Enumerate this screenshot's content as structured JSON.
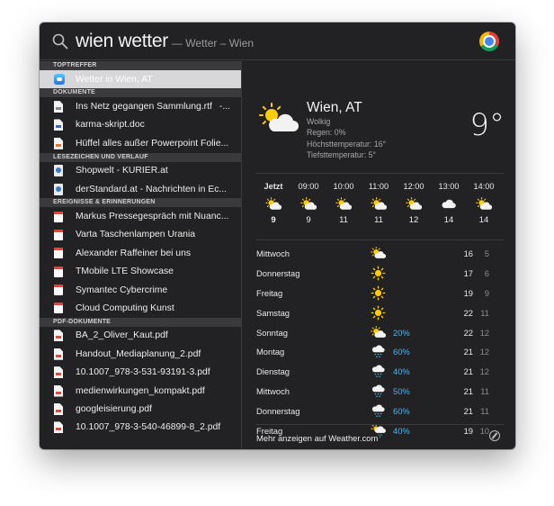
{
  "search": {
    "query": "wien wetter",
    "hint": "— Wetter – Wien"
  },
  "sections": [
    {
      "header": "TOPTREFFER",
      "items": [
        {
          "label": "Wetter in Wien, AT",
          "icon": "weather-app-icon",
          "selected": true
        }
      ]
    },
    {
      "header": "DOKUMENTE",
      "items": [
        {
          "label": "Ins Netz gegangen Sammlung.rtf",
          "suffix": "-...",
          "icon": "rtf"
        },
        {
          "label": "karma-skript.doc",
          "icon": "word"
        },
        {
          "label": "Hüffel alles außer Powerpoint Folie...",
          "icon": "ppt"
        }
      ]
    },
    {
      "header": "LESEZEICHEN UND VERLAUF",
      "items": [
        {
          "label": "Shopwelt - KURIER.at",
          "icon": "web"
        },
        {
          "label": "derStandard.at - Nachrichten in Ec...",
          "icon": "web"
        }
      ]
    },
    {
      "header": "EREIGNISSE & ERINNERUNGEN",
      "items": [
        {
          "label": "Markus Pressegespräch mit Nuanc...",
          "icon": "cal"
        },
        {
          "label": "Varta Taschenlampen Urania",
          "icon": "cal"
        },
        {
          "label": "Alexander Raffeiner bei uns",
          "icon": "cal"
        },
        {
          "label": "TMobile LTE Showcase",
          "icon": "cal"
        },
        {
          "label": "Symantec Cybercrime",
          "icon": "cal"
        },
        {
          "label": "Cloud Computing Kunst",
          "icon": "cal"
        }
      ]
    },
    {
      "header": "PDF-DOKUMENTE",
      "items": [
        {
          "label": "BA_2_Oliver_Kaut.pdf",
          "icon": "pdf"
        },
        {
          "label": "Handout_Mediaplanung_2.pdf",
          "icon": "pdf"
        },
        {
          "label": "10.1007_978-3-531-93191-3.pdf",
          "icon": "pdf"
        },
        {
          "label": "medienwirkungen_kompakt.pdf",
          "icon": "pdf"
        },
        {
          "label": "googleisierung.pdf",
          "icon": "pdf"
        },
        {
          "label": "10.1007_978-3-540-46899-8_2.pdf",
          "icon": "pdf"
        }
      ]
    }
  ],
  "weather": {
    "city": "Wien, AT",
    "condition": "Wolkig",
    "rain": "Regen: 0%",
    "high": "Höchsttemperatur: 16°",
    "low": "Tiefsttemperatur: 5°",
    "current_temp": "9°",
    "hourly": [
      {
        "time": "Jetzt",
        "temp": "9",
        "icon": "partly-sunny"
      },
      {
        "time": "09:00",
        "temp": "9",
        "icon": "partly-sunny"
      },
      {
        "time": "10:00",
        "temp": "11",
        "icon": "partly-sunny"
      },
      {
        "time": "11:00",
        "temp": "11",
        "icon": "partly-sunny"
      },
      {
        "time": "12:00",
        "temp": "12",
        "icon": "partly-sunny"
      },
      {
        "time": "13:00",
        "temp": "14",
        "icon": "cloud"
      },
      {
        "time": "14:00",
        "temp": "14",
        "icon": "partly-sunny"
      }
    ],
    "daily": [
      {
        "day": "Mittwoch",
        "icon": "partly-sunny",
        "rain": "",
        "hi": "16",
        "lo": "5"
      },
      {
        "day": "Donnerstag",
        "icon": "sun",
        "rain": "",
        "hi": "17",
        "lo": "6"
      },
      {
        "day": "Freitag",
        "icon": "sun",
        "rain": "",
        "hi": "19",
        "lo": "9"
      },
      {
        "day": "Samstag",
        "icon": "sun",
        "rain": "",
        "hi": "22",
        "lo": "11"
      },
      {
        "day": "Sonntag",
        "icon": "partly-sunny",
        "rain": "20%",
        "hi": "22",
        "lo": "12"
      },
      {
        "day": "Montag",
        "icon": "rain",
        "rain": "60%",
        "hi": "21",
        "lo": "12"
      },
      {
        "day": "Dienstag",
        "icon": "rain",
        "rain": "40%",
        "hi": "21",
        "lo": "12"
      },
      {
        "day": "Mittwoch",
        "icon": "rain",
        "rain": "50%",
        "hi": "21",
        "lo": "11"
      },
      {
        "day": "Donnerstag",
        "icon": "rain",
        "rain": "60%",
        "hi": "21",
        "lo": "11"
      },
      {
        "day": "Freitag",
        "icon": "sun-rain",
        "rain": "40%",
        "hi": "19",
        "lo": "10"
      }
    ],
    "more_label": "Mehr anzeigen auf Weather.com"
  },
  "colors": {
    "background": "#222224",
    "accent_rain": "#4fb2ea",
    "sun": "#ffcc00",
    "selection": "#d7d7d9"
  }
}
